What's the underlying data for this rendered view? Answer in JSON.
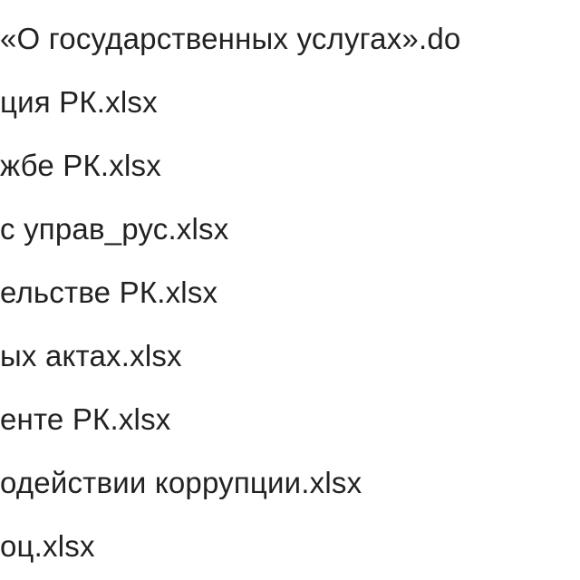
{
  "files": {
    "item0": "«О государственных услугах».do",
    "item1": "ция РК.xlsx",
    "item2": "жбе РК.xlsx",
    "item3": "с управ_рус.xlsx",
    "item4": "ельстве РК.xlsx",
    "item5": "ых актах.xlsx",
    "item6": "енте РК.xlsx",
    "item7": "одействии коррупции.xlsx",
    "item8": "оц.xlsx"
  }
}
